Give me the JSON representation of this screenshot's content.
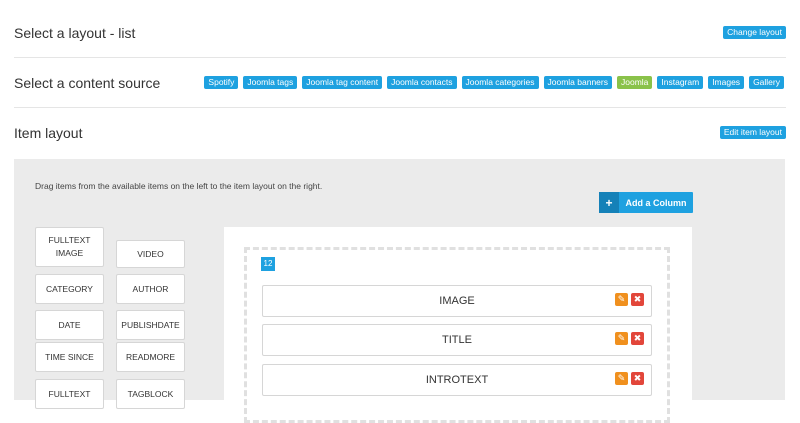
{
  "layout_section": {
    "title": "Select a layout - list",
    "button": "Change layout"
  },
  "source_section": {
    "title": "Select a content source",
    "sources": [
      {
        "label": "Spotify",
        "active": false
      },
      {
        "label": "Joomla tags",
        "active": false
      },
      {
        "label": "Joomla tag content",
        "active": false
      },
      {
        "label": "Joomla contacts",
        "active": false
      },
      {
        "label": "Joomla categories",
        "active": false
      },
      {
        "label": "Joomla banners",
        "active": false
      },
      {
        "label": "Joomla",
        "active": true
      },
      {
        "label": "Instagram",
        "active": false
      },
      {
        "label": "Images",
        "active": false
      },
      {
        "label": "Gallery",
        "active": false
      }
    ]
  },
  "item_layout_section": {
    "title": "Item layout",
    "button": "Edit item layout",
    "hint": "Drag items from the available items on the left to the item layout on the right.",
    "add_column": "Add a Column",
    "available_items": [
      "FULLTEXT IMAGE",
      "VIDEO",
      "CATEGORY",
      "AUTHOR",
      "DATE",
      "PUBLISHDATE",
      "TIME SINCE",
      "READMORE",
      "FULLTEXT",
      "TAGBLOCK"
    ],
    "column_size": "12",
    "layout_items": [
      "IMAGE",
      "TITLE",
      "INTROTEXT"
    ]
  },
  "colors": {
    "accent": "#1ea1e0",
    "active_source": "#8ac24a",
    "edit": "#f0901e",
    "delete": "#e2463a",
    "panel": "#ebebeb"
  }
}
